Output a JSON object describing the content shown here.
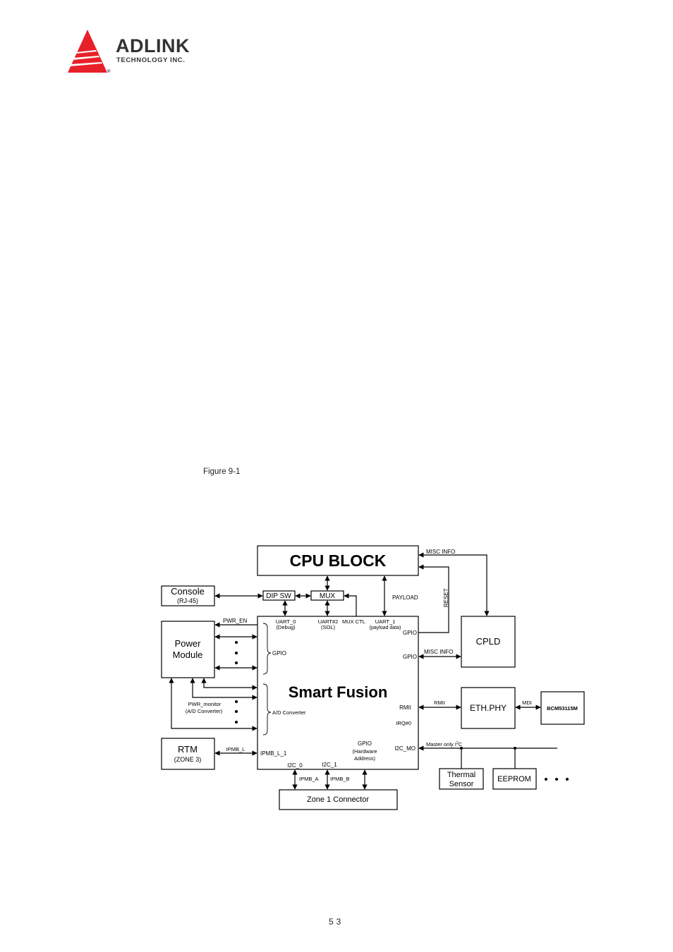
{
  "header": {
    "brand_name": "ADLINK",
    "brand_subtitle": "TECHNOLOGY INC.",
    "brand_color": "#e8202a",
    "registered_mark": "®"
  },
  "figure": {
    "caption": "Figure 9-1"
  },
  "diagram": {
    "blocks": {
      "cpu_block": "CPU BLOCK",
      "console": "Console",
      "console_sub": "(RJ-45)",
      "dip_sw": "DIP SW",
      "mux": "MUX",
      "power_module_line1": "Power",
      "power_module_line2": "Module",
      "smart_fusion": "Smart Fusion",
      "cpld": "CPLD",
      "eth_phy": "ETH.PHY",
      "bcm": "BCM53115M",
      "rtm": "RTM",
      "rtm_sub": "(ZONE 3)",
      "zone1": "Zone 1 Connector",
      "thermal_line1": "Thermal",
      "thermal_line2": "Sensor",
      "eeprom": "EEPROM"
    },
    "labels": {
      "misc_info_top": "MISC INFO",
      "reset": "RESET",
      "payload": "PAYLOAD",
      "pwr_en": "PWR_EN",
      "uart0": "UART_0",
      "uart0_sub": "(Debug)",
      "uart2": "UART#2",
      "uart2_sub": "(SOL)",
      "mux_ctl": "MUX CTL",
      "uart1": "UART_1",
      "uart1_sub": "(payload data)",
      "gpio_reset": "GPIO",
      "gpio_misc": "GPIO",
      "misc_info_cpld": "MISC INFO",
      "gpio_brace": "GPIO",
      "ad_brace": "A/D Converter",
      "pwr_monitor": "PWR_monitor",
      "pwr_monitor_sub": "(A/D Converter)",
      "rmii_in": "RMII",
      "rmii_link": "RMII",
      "mdi": "MDI",
      "irq": "IRQ#0",
      "i2c_mo": "I2C_MO",
      "master_only": "Master only I",
      "master_only_sup": "2",
      "master_only_end": "C",
      "gpio_hw": "GPIO",
      "gpio_hw_sub1": "(Hardware",
      "gpio_hw_sub2": "Address)",
      "ipmb_l": "IPMB_L",
      "ipmb_l_1": "IPMB_L_1",
      "i2c_0": "I2C_0",
      "i2c_1": "I2C_1",
      "ipmb_a": "IPMB_A",
      "ipmb_b": "IPMB_B"
    }
  },
  "footer": {
    "page_number": "53"
  }
}
